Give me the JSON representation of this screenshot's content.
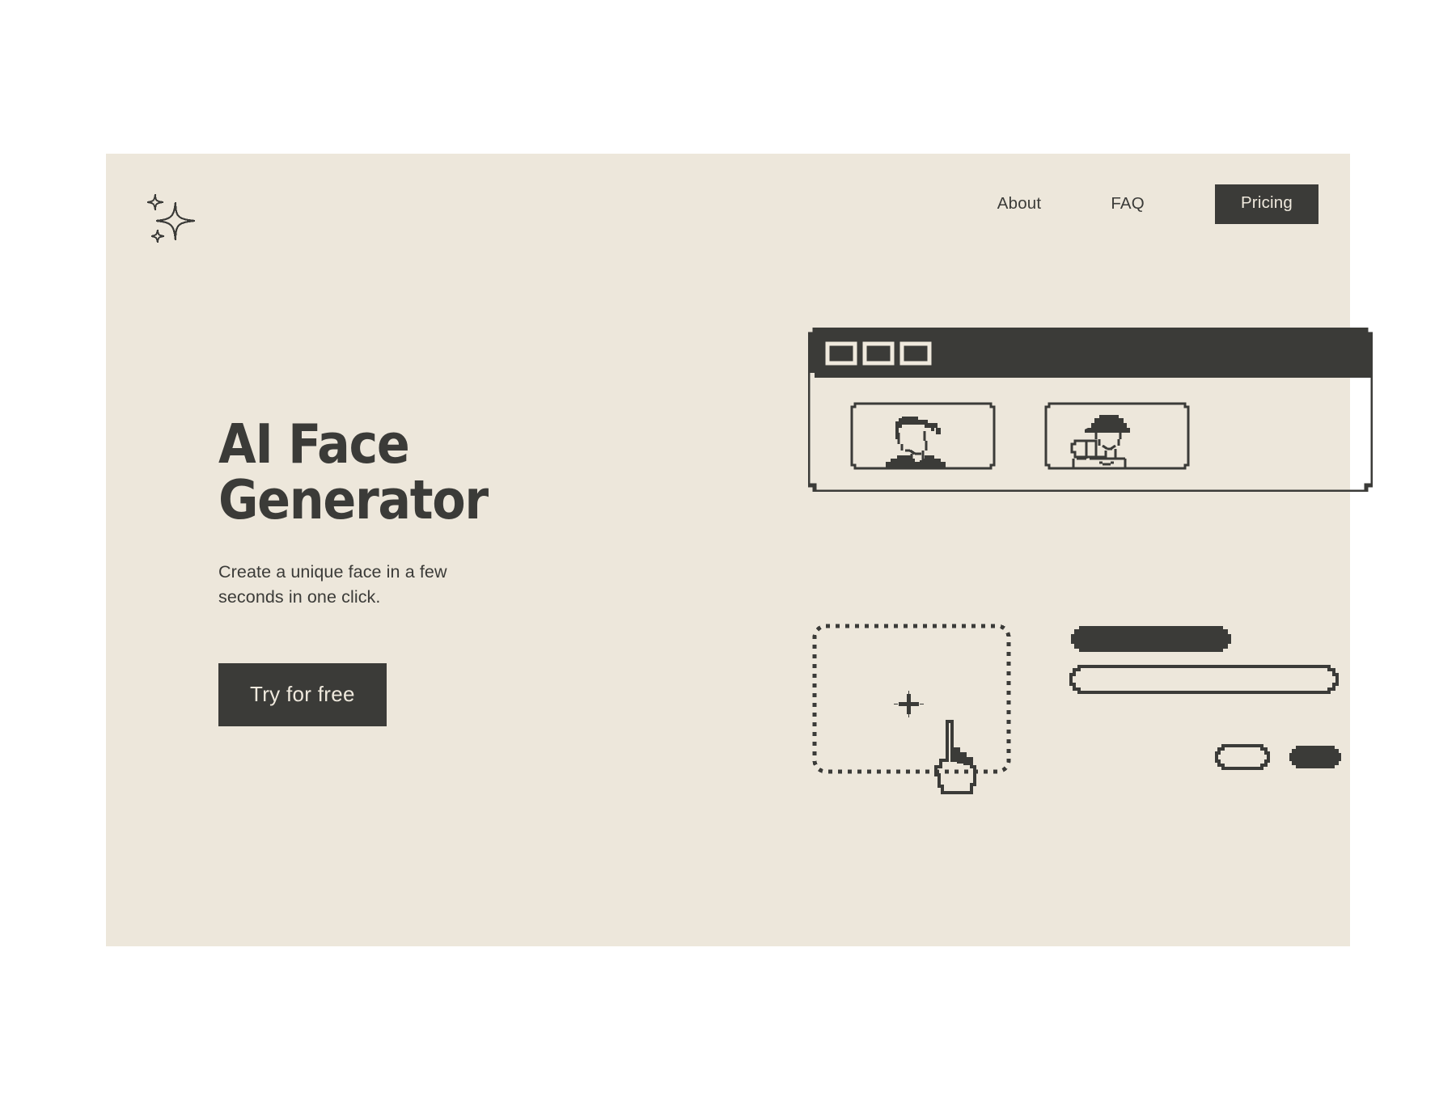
{
  "page": {
    "background": "#FFFFFF",
    "card_background": "#EDE7DB",
    "ink": "#3B3B38",
    "cream": "#EFE9DD"
  },
  "nav": {
    "logo_name": "sparkle-logo-icon",
    "links": [
      {
        "label": "About"
      },
      {
        "label": "FAQ"
      }
    ],
    "cta": {
      "label": "Pricing"
    }
  },
  "hero": {
    "headline": "AI Face\nGenerator",
    "subhead": "Create a unique face in a few\nseconds in one click.",
    "button_label": "Try for free"
  },
  "illustration": {
    "browser": {
      "name": "browser-window-mockup",
      "titlebar_buttons": 3,
      "panels": [
        {
          "name": "generated-face-panel-1",
          "subject": "person-short-dark-hair-dark-shirt"
        },
        {
          "name": "generated-face-panel-2",
          "subject": "person-with-cap-raised-arm"
        }
      ]
    },
    "upload": {
      "name": "dashed-upload-dropzone",
      "glyph": "plus-sparkle-icon",
      "cursor": "pointing-hand-cursor"
    },
    "bars": [
      {
        "name": "filled-bar-long",
        "style": "filled"
      },
      {
        "name": "outlined-bar-long",
        "style": "outlined"
      },
      {
        "name": "outlined-pill-small",
        "style": "outlined"
      },
      {
        "name": "filled-pill-small",
        "style": "filled"
      }
    ]
  }
}
